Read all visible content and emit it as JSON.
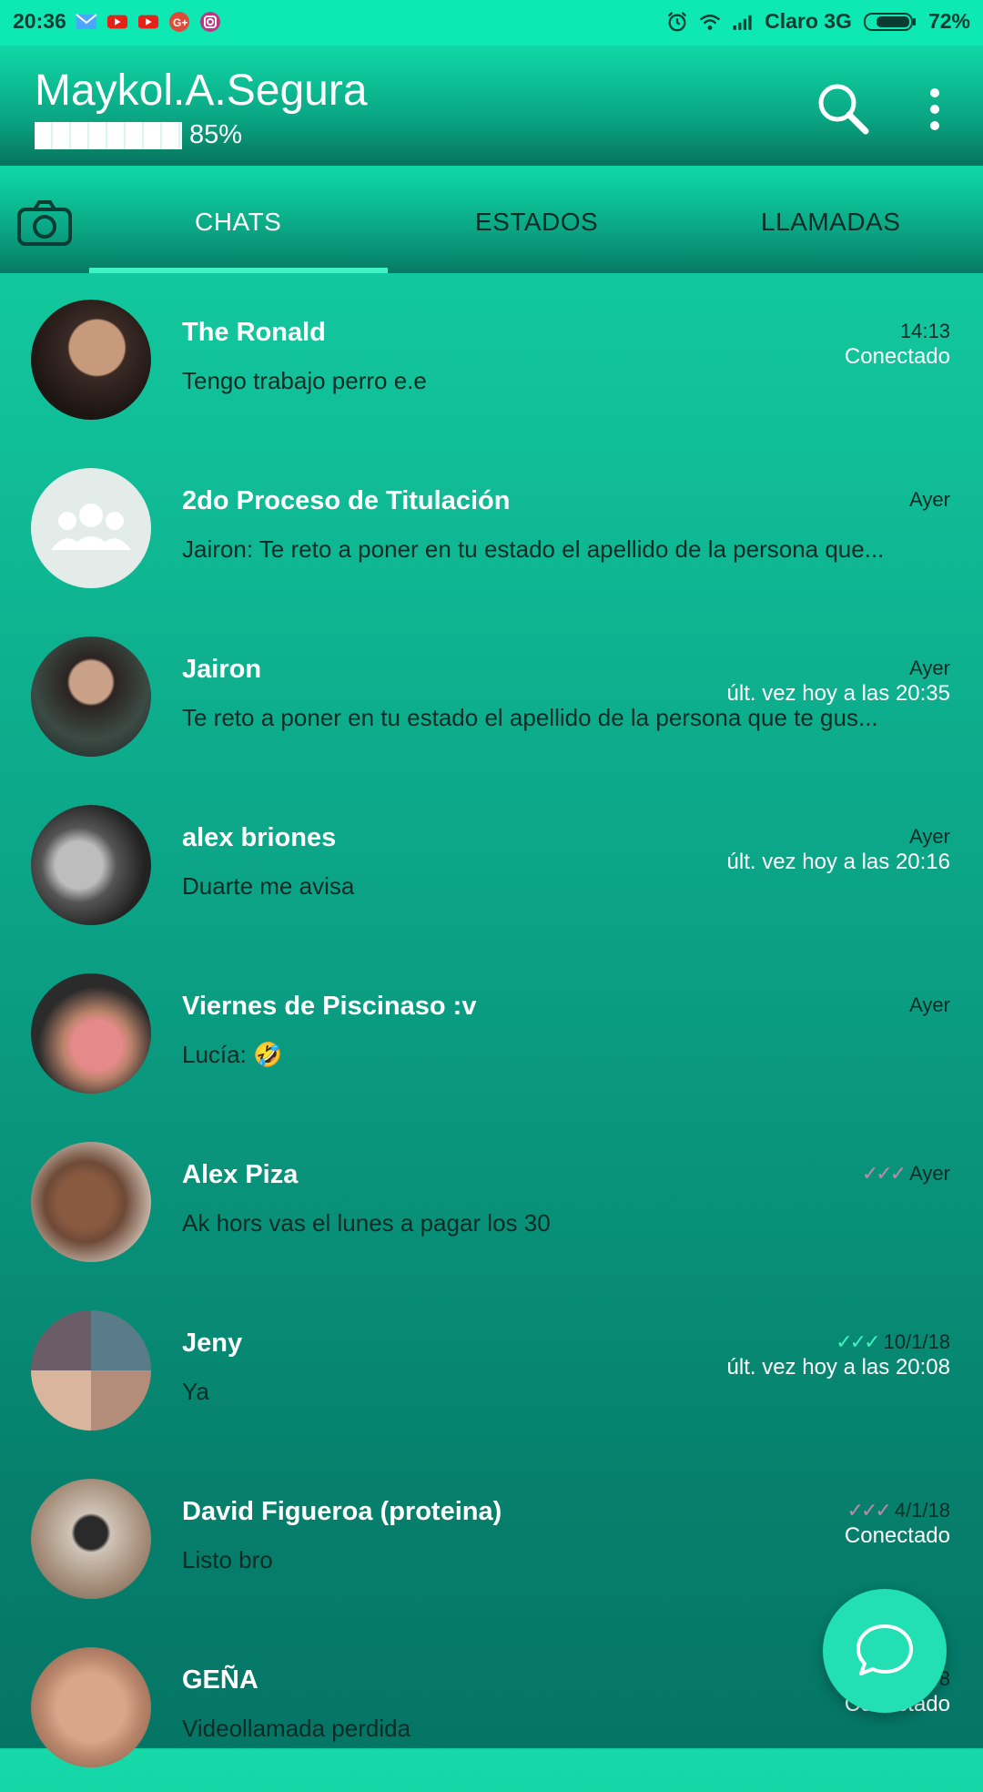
{
  "statusbar": {
    "time": "20:36",
    "carrier": "Claro 3G",
    "battery": "72%",
    "notification_icons": [
      "mail-icon",
      "youtube-icon",
      "youtube-icon",
      "google-plus-icon",
      "instagram-icon"
    ],
    "right_icons": [
      "alarm-icon",
      "wifi-icon",
      "signal-icon",
      "battery-icon"
    ]
  },
  "header": {
    "title": "Maykol.A.Segura",
    "battery_percent": "85%",
    "battery_level": 0.85
  },
  "tabs": [
    {
      "label": "CHATS",
      "active": true
    },
    {
      "label": "ESTADOS",
      "active": false
    },
    {
      "label": "LLAMADAS",
      "active": false
    }
  ],
  "chats": [
    {
      "name": "The Ronald",
      "preview": "Tengo trabajo perro e.e",
      "time": "14:13",
      "status": "Conectado",
      "ticks": ""
    },
    {
      "name": "2do Proceso de Titulación",
      "preview": "Jairon: Te reto a poner en tu estado el apellido de la persona que...",
      "time": "Ayer",
      "status": "",
      "ticks": ""
    },
    {
      "name": "Jairon",
      "preview": "Te reto a poner en tu estado el apellido de la persona que te gus...",
      "time": "Ayer",
      "status": "últ. vez hoy a las 20:35",
      "ticks": ""
    },
    {
      "name": "alex briones",
      "preview": "Duarte me avisa",
      "time": "Ayer",
      "status": "últ. vez hoy a las 20:16",
      "ticks": ""
    },
    {
      "name": "Viernes de Piscinaso :v",
      "preview": "Lucía: 🤣",
      "time": "Ayer",
      "status": "",
      "ticks": ""
    },
    {
      "name": "Alex Piza",
      "preview": "Ak hors vas el lunes a pagar los 30",
      "time": "Ayer",
      "status": "",
      "ticks": "✓✓✓"
    },
    {
      "name": "Jeny",
      "preview": "Ya",
      "time": "10/1/18",
      "status": "últ. vez hoy a las 20:08",
      "ticks": "✓✓✓"
    },
    {
      "name": "David Figueroa (proteina)",
      "preview": "Listo bro",
      "time": "4/1/18",
      "status": "Conectado",
      "ticks": "✓✓✓"
    },
    {
      "name": "GEÑA",
      "preview": "Videollamada perdida",
      "time": "8",
      "status": "Conectado",
      "ticks": ""
    }
  ],
  "colors": {
    "accent": "#3ff2c3",
    "header": "#0aa683",
    "fab": "#22e0b3"
  }
}
